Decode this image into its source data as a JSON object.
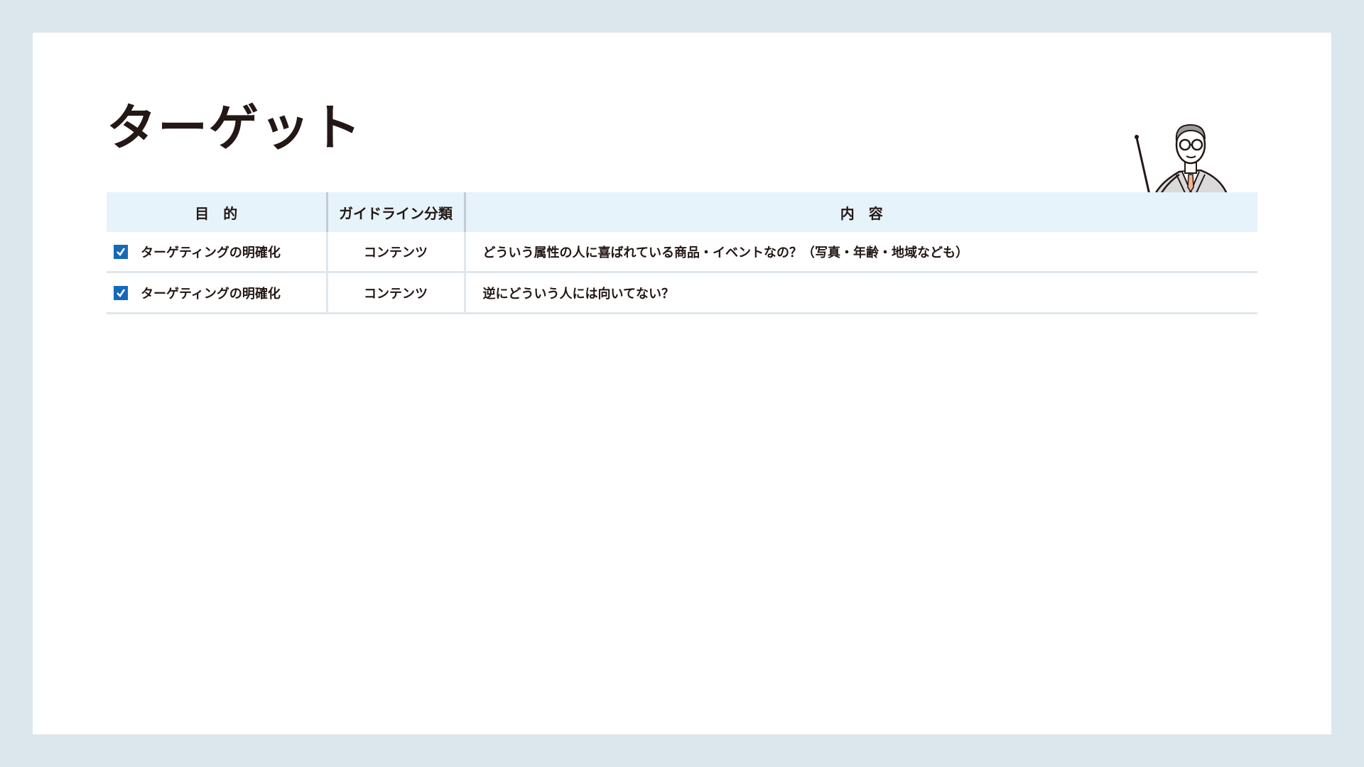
{
  "slide": {
    "title": "ターゲット"
  },
  "table": {
    "headers": {
      "purpose": "目　的",
      "guideline": "ガイドライン分類",
      "content": "内　容"
    },
    "rows": [
      {
        "checked": true,
        "purpose": "ターゲティングの明確化",
        "guideline": "コンテンツ",
        "content": "どういう属性の人に喜ばれている商品・イベントなの？（写真・年齢・地域なども）"
      },
      {
        "checked": true,
        "purpose": "ターゲティングの明確化",
        "guideline": "コンテンツ",
        "content": "逆にどういう人には向いてない？"
      }
    ]
  },
  "colors": {
    "background": "#dce6ed",
    "header_fill": "#e6f3fb",
    "checkbox": "#1569b8",
    "text": "#231815",
    "row_border": "#dfe7ec"
  },
  "icons": {
    "illustration": "teacher-with-pointer-icon",
    "checkbox": "checked-checkbox-icon"
  }
}
